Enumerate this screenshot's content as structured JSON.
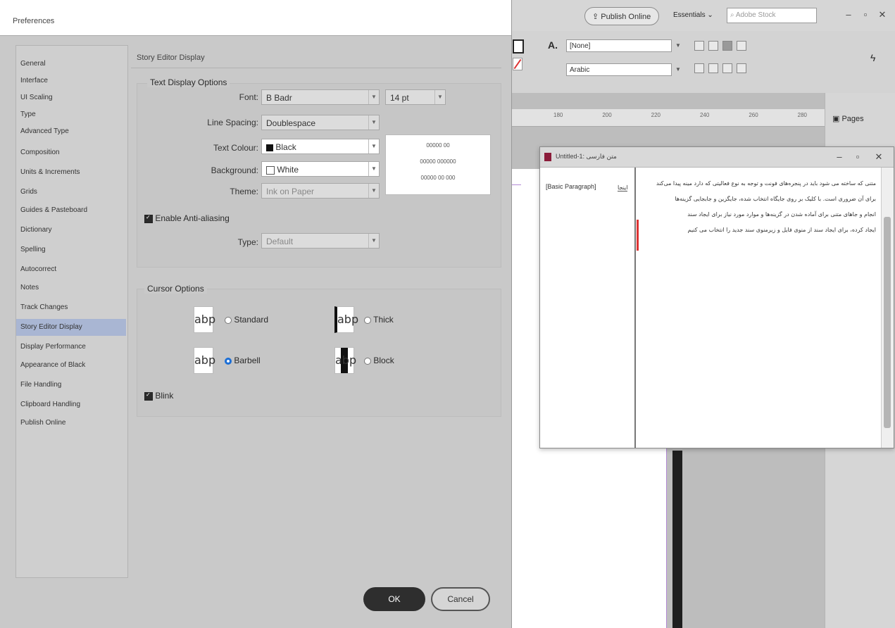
{
  "dialog": {
    "title": "Preferences",
    "section_title": "Story Editor Display",
    "nav": [
      "General",
      "Interface",
      "UI Scaling",
      "Type",
      "Advanced Type",
      "Composition",
      "Units & Increments",
      "Grids",
      "Guides & Pasteboard",
      "Dictionary",
      "Spelling",
      "Autocorrect",
      "Notes",
      "Track Changes",
      "Story Editor Display",
      "Display Performance",
      "Appearance of Black",
      "File Handling",
      "Clipboard Handling",
      "Publish Online"
    ],
    "selected_nav": "Story Editor Display",
    "text_display": {
      "group_title": "Text Display Options",
      "font_label": "Font:",
      "font_value": "B Badr",
      "size_value": "14 pt",
      "line_spacing_label": "Line Spacing:",
      "line_spacing_value": "Doublespace",
      "text_colour_label": "Text Colour:",
      "text_colour_value": "Black",
      "background_label": "Background:",
      "background_value": "White",
      "theme_label": "Theme:",
      "theme_value": "Ink on Paper",
      "preview_lines": [
        "00000 00",
        "00000 000000",
        "00000 00 000"
      ],
      "antialias_label": "Enable Anti-aliasing",
      "type_label": "Type:",
      "type_value": "Default"
    },
    "cursor_options": {
      "group_title": "Cursor Options",
      "standard_label": "Standard",
      "thick_label": "Thick",
      "barbell_label": "Barbell",
      "block_label": "Block",
      "selected": "Barbell",
      "preview_glyph": "abp",
      "blink_label": "Blink"
    },
    "ok_label": "OK",
    "cancel_label": "Cancel"
  },
  "app": {
    "publish_label": "Publish Online",
    "workspace_label": "Essentials",
    "search_placeholder": "Adobe Stock",
    "paragraph_style": "[None]",
    "language": "Arabic",
    "pages_panel_label": "Pages",
    "ruler_ticks": [
      "180",
      "200",
      "220",
      "240",
      "260",
      "280"
    ]
  },
  "story_editor": {
    "title": "Untitled-1: متن فارسی",
    "style_label": "[Basic Paragraph]",
    "depth_label": "اینجا",
    "text_lines": [
      "متنی که ساخته می شود باید در پنجره‌های فونت و توجه به نوع فعالیتی که دارد مینه پیدا می‌کند",
      "برای آن ضروری است. با کلیک بر روی جایگاه انتخاب شده، جایگزین و جابجایی گزینه‌ها",
      "انجام و جاهای متنی برای آماده شدن در گزینه‌ها و موارد مورد نیاز برای ایجاد سند",
      "ایجاد کرده، برای ایجاد سند از منوی فایل و زیرمنوی سند جدید را انتخاب می کنیم"
    ]
  }
}
